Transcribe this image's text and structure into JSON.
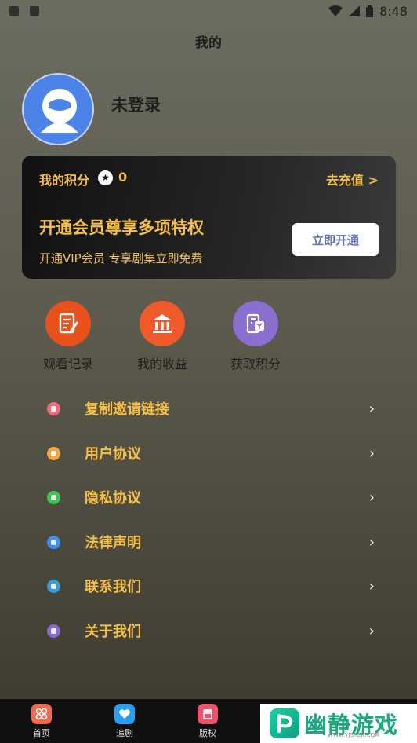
{
  "status_bar": {
    "time": "8:48"
  },
  "header": {
    "title": "我的"
  },
  "profile": {
    "username": "未登录"
  },
  "vip_card": {
    "points_label": "我的积分",
    "points_icon": "star-icon",
    "points_value": "0",
    "recharge_link": "去充值 >",
    "title": "开通会员尊享多项特权",
    "subtitle": "开通VIP会员 专享剧集立即免费",
    "open_button": "立即开通"
  },
  "quick_actions": [
    {
      "label": "观看记录",
      "icon": "history-icon",
      "color": "#e8501c"
    },
    {
      "label": "我的收益",
      "icon": "bank-icon",
      "color": "#ee5a2a"
    },
    {
      "label": "获取积分",
      "icon": "points-icon",
      "color": "#8a6fd0"
    }
  ],
  "menu": [
    {
      "label": "复制邀请链接",
      "icon": "tag-icon",
      "color": "#f06a7e"
    },
    {
      "label": "用户协议",
      "icon": "document-icon",
      "color": "#f5a53c"
    },
    {
      "label": "隐私协议",
      "icon": "lock-icon",
      "color": "#3cc455"
    },
    {
      "label": "法律声明",
      "icon": "flag-icon",
      "color": "#3c8ef0"
    },
    {
      "label": "联系我们",
      "icon": "phone-icon",
      "color": "#3a9ad8"
    },
    {
      "label": "关于我们",
      "icon": "info-icon",
      "color": "#8a6ad0"
    }
  ],
  "tabs": [
    {
      "label": "首页",
      "icon": "home-icon",
      "color": "#f06a50"
    },
    {
      "label": "追剧",
      "icon": "heart-icon",
      "color": "#2a9df4"
    },
    {
      "label": "版权",
      "icon": "shop-icon",
      "color": "#f0506e"
    }
  ],
  "watermark": {
    "text": "幽静游戏",
    "url": "WWW.YJSREN.COM"
  },
  "colors": {
    "accent": "#f5c04a",
    "card_bg": "#1a1a1a",
    "tab_bg": "#101010"
  }
}
